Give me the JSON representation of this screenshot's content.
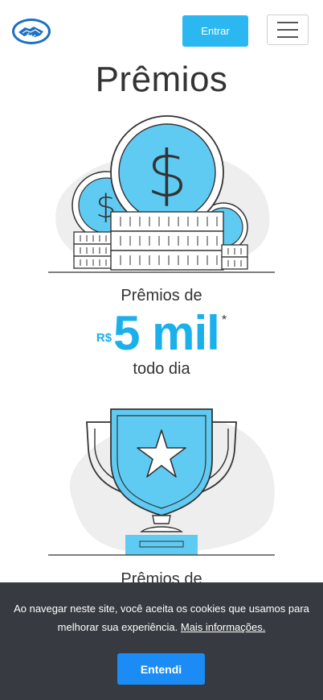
{
  "header": {
    "logo_icon": "mercado-pago-handshake-logo",
    "login_label": "Entrar",
    "menu_icon": "hamburger-icon",
    "accent": "#2bb8f0"
  },
  "page": {
    "title": "Prêmios"
  },
  "prizes": [
    {
      "icon": "coins-illustration",
      "label": "Prêmios de",
      "currency": "R$",
      "amount": "5 mil",
      "asterisk": "*",
      "sub": "todo dia",
      "color": "#1ab0ec"
    },
    {
      "icon": "trophy-illustration",
      "label": "Prêmios de"
    }
  ],
  "cookie": {
    "text": "Ao navegar neste site, você aceita os cookies que usamos para melhorar sua experiência.",
    "link": "Mais informações.",
    "button": "Entendi",
    "background": "#373a40",
    "button_color": "#1b8cf6"
  }
}
